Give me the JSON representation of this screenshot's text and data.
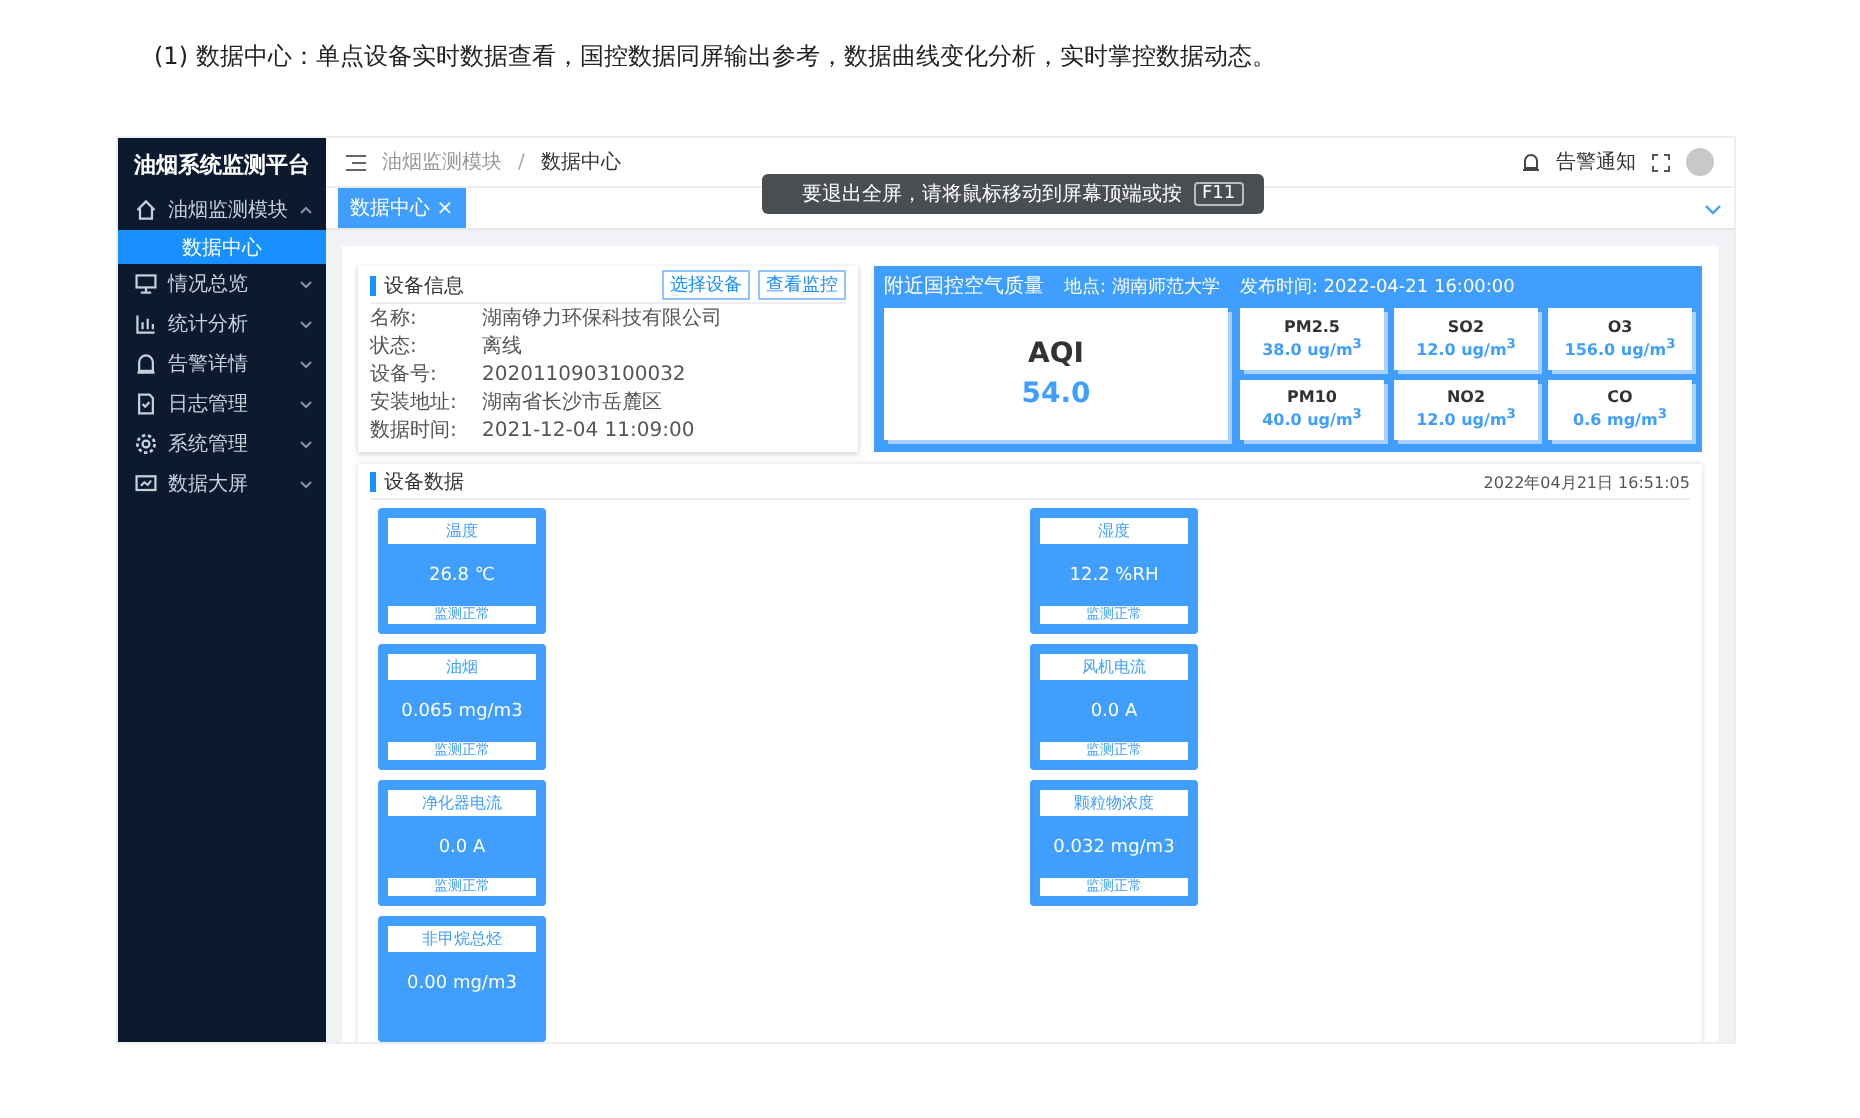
{
  "caption": "(1) 数据中心：单点设备实时数据查看，国控数据同屏输出参考，数据曲线变化分析，实时掌控数据动态。",
  "sidebar": {
    "title": "油烟系统监测平台",
    "items": [
      {
        "kind": "home",
        "label": "油烟监测模块",
        "expanded": true,
        "children": [
          {
            "label": "数据中心",
            "selected": true
          }
        ]
      },
      {
        "kind": "monitor",
        "label": "情况总览",
        "expanded": false
      },
      {
        "kind": "chart",
        "label": "统计分析",
        "expanded": false
      },
      {
        "kind": "alarm",
        "label": "告警详情",
        "expanded": false
      },
      {
        "kind": "doc",
        "label": "日志管理",
        "expanded": false
      },
      {
        "kind": "gear",
        "label": "系统管理",
        "expanded": false
      },
      {
        "kind": "screen",
        "label": "数据大屏",
        "expanded": false
      }
    ]
  },
  "breadcrumb": [
    "油烟监测模块",
    "数据中心"
  ],
  "breadcrumb_separator": "/",
  "header_right": {
    "notice": "告警通知"
  },
  "toast": {
    "text": "要退出全屏，请将鼠标移动到屏幕顶端或按",
    "key": "F11"
  },
  "tabs": [
    {
      "label": "数据中心",
      "close": "×",
      "selected": true
    }
  ],
  "device_info": {
    "title": "设备信息",
    "buttons": [
      "选择设备",
      "查看监控"
    ],
    "fields": [
      {
        "label": "名称:",
        "value": "湖南铮力环保科技有限公司"
      },
      {
        "label": "状态:",
        "value": "离线"
      },
      {
        "label": "设备号:",
        "value": "2020110903100032"
      },
      {
        "label": "安装地址:",
        "value": "湖南省长沙市岳麓区"
      },
      {
        "label": "数据时间:",
        "value": "2021-12-04 11:09:00"
      }
    ]
  },
  "air_quality": {
    "title": "附近国控空气质量",
    "location": "地点: 湖南师范大学",
    "time": "发布时间: 2022-04-21 16:00:00",
    "aqi": {
      "label": "AQI",
      "value": "54.0"
    },
    "pollutants": [
      {
        "name": "PM2.5",
        "value": "38.0 ug/m$^{3}$"
      },
      {
        "name": "SO2",
        "value": "12.0 ug/m$^{3}$"
      },
      {
        "name": "O3",
        "value": "156.0 ug/m$^{3}$"
      },
      {
        "name": "PM10",
        "value": "40.0 ug/m$^{3}$"
      },
      {
        "name": "NO2",
        "value": "12.0 ug/m$^{3}$"
      },
      {
        "name": "CO",
        "value": "0.6 mg/m$^{3}$"
      }
    ]
  },
  "device_data": {
    "title": "设备数据",
    "timestamp": "2022年04月21日 16:51:05",
    "cards": [
      {
        "name": "温度",
        "value": "26.8 ℃",
        "status": "监测正常"
      },
      {
        "name": "湿度",
        "value": "12.2 %RH",
        "status": "监测正常"
      },
      {
        "name": "油烟",
        "value": "0.065 mg/m3",
        "status": "监测正常"
      },
      {
        "name": "风机电流",
        "value": "0.0 A",
        "status": "监测正常"
      },
      {
        "name": "净化器电流",
        "value": "0.0 A",
        "status": "监测正常"
      },
      {
        "name": "颗粒物浓度",
        "value": "0.032 mg/m3",
        "status": "监测正常"
      },
      {
        "name": "非甲烷总烃",
        "value": "0.00 mg/m3"
      }
    ]
  }
}
